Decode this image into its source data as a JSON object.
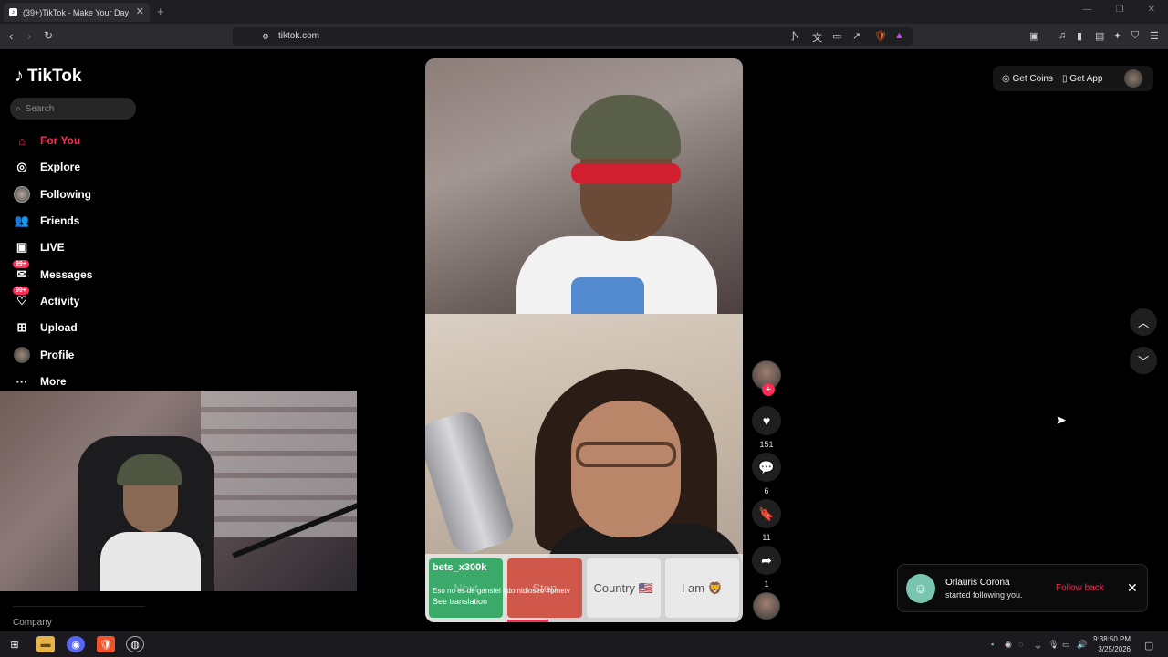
{
  "browser": {
    "tab_title": "(39+)TikTok - Make Your Day",
    "url": "tiktok.com"
  },
  "app": {
    "brand": "TikTok",
    "search_placeholder": "Search",
    "nav": [
      {
        "label": "For You",
        "icon": "home-icon",
        "active": true
      },
      {
        "label": "Explore",
        "icon": "compass-icon"
      },
      {
        "label": "Following",
        "icon": "avatar-icon"
      },
      {
        "label": "Friends",
        "icon": "friends-icon"
      },
      {
        "label": "LIVE",
        "icon": "live-icon"
      },
      {
        "label": "Messages",
        "icon": "messages-icon",
        "badge": "99+"
      },
      {
        "label": "Activity",
        "icon": "activity-icon",
        "badge": "99+"
      },
      {
        "label": "Upload",
        "icon": "upload-icon"
      },
      {
        "label": "Profile",
        "icon": "profile-icon"
      },
      {
        "label": "More",
        "icon": "more-icon"
      }
    ],
    "footer_company": "Company",
    "top_right": {
      "get_coins": "Get Coins",
      "get_app": "Get App"
    }
  },
  "video": {
    "comment_user": "bets_x300k",
    "comment_text": "Eso no es de ganstel #domidioseo #ometv",
    "see_translation": "See translation",
    "game_buttons": [
      "Next",
      "Stop",
      "Country 🇺🇸",
      "I am 🦁"
    ]
  },
  "actions": {
    "likes": "151",
    "comments": "6",
    "saves": "11",
    "shares": "1"
  },
  "notification": {
    "name": "Orlauris Corona",
    "message": "started following you.",
    "action": "Follow back"
  },
  "taskbar": {
    "time": "9:38:50 PM",
    "date": "3/25/2026"
  },
  "colors": {
    "accent": "#fe2c55",
    "background": "#000000"
  }
}
